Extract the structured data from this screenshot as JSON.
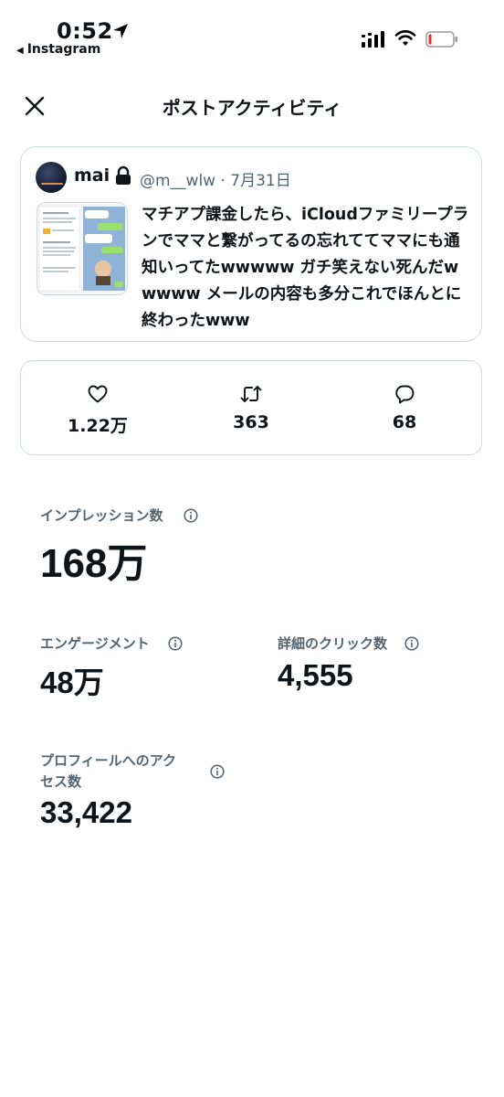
{
  "status_bar": {
    "time": "0:52",
    "back_app": "Instagram"
  },
  "header": {
    "title": "ポストアクティビティ"
  },
  "tweet": {
    "user_name": "mai",
    "handle_date": "@m__wlw · 7月31日",
    "text": "マチアプ課金したら、iCloudファミリープランでママと繋がってるの忘れててママにも通知いってたwwwww ガチ笑えない死んだwwwww メールの内容も多分これでほんとに終わったwww"
  },
  "actions": {
    "likes": "1.22万",
    "retweets": "363",
    "replies": "68"
  },
  "metrics": {
    "impressions": {
      "label": "インプレッション数",
      "value": "168万"
    },
    "engagements": {
      "label": "エンゲージメント",
      "value": "48万"
    },
    "detail_clicks": {
      "label": "詳細のクリック数",
      "value": "4,555"
    },
    "profile_visits": {
      "label_line1": "プロフィールへのアク",
      "label_line2": "セス数",
      "value": "33,422"
    }
  },
  "colors": {
    "text": "#0f1419",
    "secondary": "#536471",
    "border": "#cfd9de",
    "battery_low": "#e0312d"
  }
}
